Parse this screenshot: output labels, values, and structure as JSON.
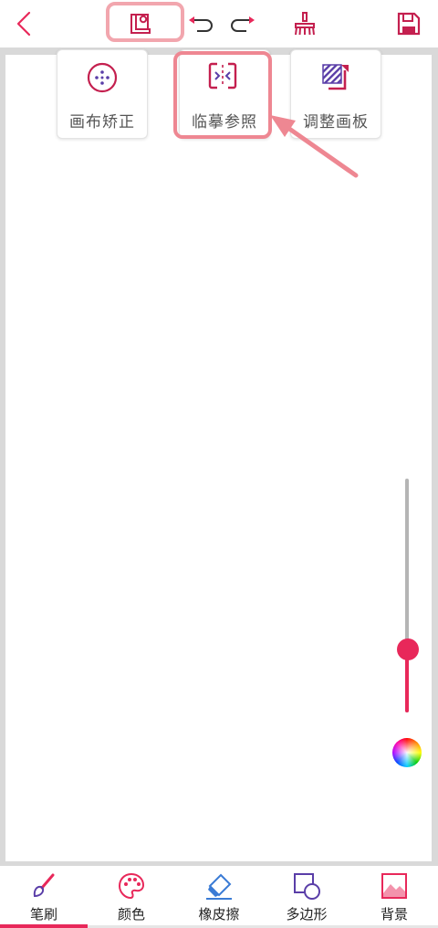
{
  "toolbar": {
    "back": "back-icon",
    "layers": "layers-icon",
    "undo": "undo-icon",
    "redo": "redo-icon",
    "clear": "brush-clean-icon",
    "save": "save-icon"
  },
  "popup_menu": {
    "items": [
      {
        "label": "画布矫正",
        "icon": "canvas-correct-icon"
      },
      {
        "label": "临摹参照",
        "icon": "trace-reference-icon"
      },
      {
        "label": "调整画板",
        "icon": "adjust-board-icon"
      }
    ]
  },
  "slider": {
    "value_fraction": 0.27
  },
  "bottom_nav": {
    "items": [
      {
        "label": "笔刷",
        "icon": "brush-icon"
      },
      {
        "label": "颜色",
        "icon": "palette-icon"
      },
      {
        "label": "橡皮擦",
        "icon": "eraser-icon"
      },
      {
        "label": "多边形",
        "icon": "polygon-icon"
      },
      {
        "label": "背景",
        "icon": "background-image-icon"
      }
    ],
    "active_index": 0
  },
  "colors": {
    "accent": "#e8285a",
    "highlight": "#ee8792",
    "purple": "#5a3ea8"
  }
}
